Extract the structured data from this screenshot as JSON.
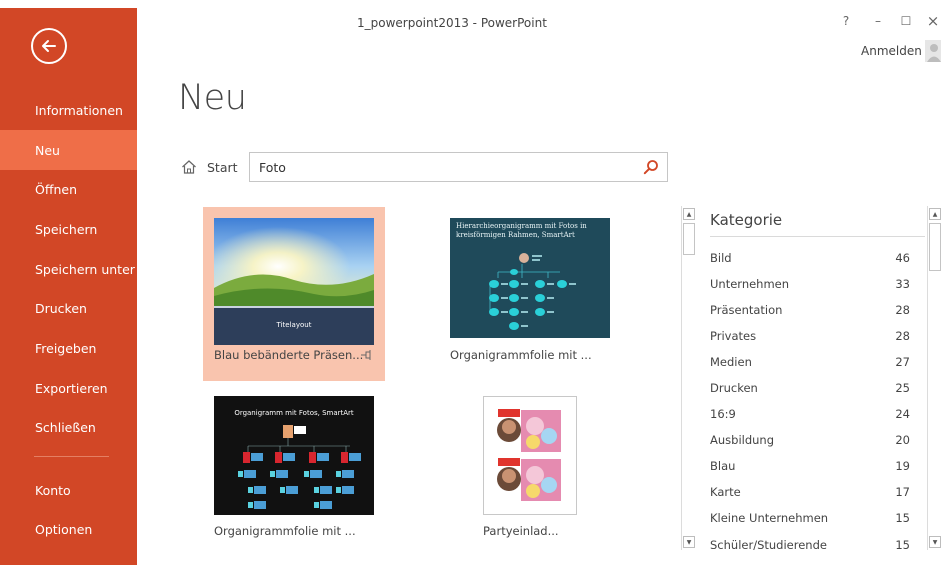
{
  "window": {
    "title": "1_powerpoint2013 - PowerPoint",
    "help": "?",
    "minimize": "–",
    "maximize": "☐",
    "close": "×",
    "signin": "Anmelden"
  },
  "sidebar": {
    "items": [
      {
        "label": "Informationen"
      },
      {
        "label": "Neu"
      },
      {
        "label": "Öffnen"
      },
      {
        "label": "Speichern"
      },
      {
        "label": "Speichern unter"
      },
      {
        "label": "Drucken"
      },
      {
        "label": "Freigeben"
      },
      {
        "label": "Exportieren"
      },
      {
        "label": "Schließen"
      },
      {
        "label": "Konto"
      },
      {
        "label": "Optionen"
      }
    ],
    "active_index": 1
  },
  "page": {
    "title": "Neu"
  },
  "breadcrumb": {
    "start": "Start"
  },
  "search": {
    "value": "Foto"
  },
  "templates": [
    {
      "label": "Blau bebänderte Präsen...",
      "thumb_title": "Titelayout",
      "selected": true
    },
    {
      "label": "Organigrammfolie mit ...",
      "thumb_title": "Hierarchieorganigramm mit Fotos in kreisförmigen Rahmen, SmartArt"
    },
    {
      "label": "Organigrammfolie mit ...",
      "thumb_title": "Organigramm mit Fotos, SmartArt"
    },
    {
      "label": "Partyeinlad..."
    }
  ],
  "categories": {
    "title": "Kategorie",
    "items": [
      {
        "name": "Bild",
        "count": "46"
      },
      {
        "name": "Unternehmen",
        "count": "33"
      },
      {
        "name": "Präsentation",
        "count": "28"
      },
      {
        "name": "Privates",
        "count": "28"
      },
      {
        "name": "Medien",
        "count": "27"
      },
      {
        "name": "Drucken",
        "count": "25"
      },
      {
        "name": "16:9",
        "count": "24"
      },
      {
        "name": "Ausbildung",
        "count": "20"
      },
      {
        "name": "Blau",
        "count": "19"
      },
      {
        "name": "Karte",
        "count": "17"
      },
      {
        "name": "Kleine Unternehmen",
        "count": "15"
      },
      {
        "name": "Schüler/Studierende",
        "count": "15"
      }
    ]
  },
  "colors": {
    "accent": "#d24726",
    "sidebar_active": "#ef6e48",
    "template_selected": "#f9c4ae"
  }
}
